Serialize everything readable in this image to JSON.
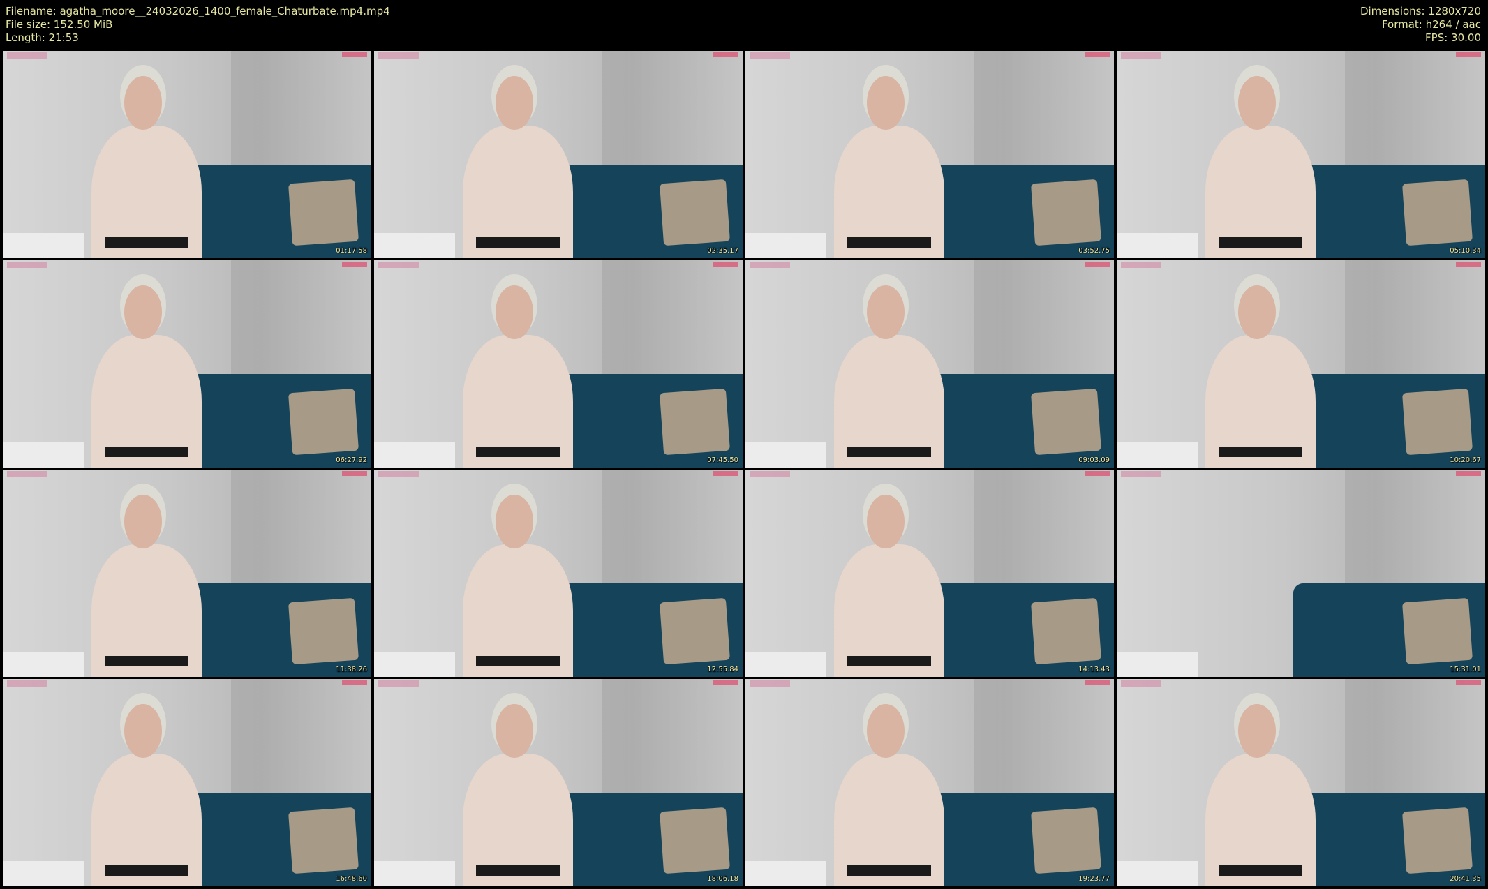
{
  "header": {
    "filename_line": "Filename: agatha_moore__24032026_1400_female_Chaturbate.mp4.mp4",
    "filesize_line": "File size: 152.50 MiB",
    "length_line": "Length: 21:53",
    "dimensions_line": "Dimensions: 1280x720",
    "format_line": "Format: h264 / aac",
    "fps_line": "FPS: 30.00"
  },
  "thumbnails": [
    {
      "timestamp": "01:17.58"
    },
    {
      "timestamp": "02:35.17"
    },
    {
      "timestamp": "03:52.75"
    },
    {
      "timestamp": "05:10.34"
    },
    {
      "timestamp": "06:27.92"
    },
    {
      "timestamp": "07:45.50"
    },
    {
      "timestamp": "09:03.09"
    },
    {
      "timestamp": "10:20.67"
    },
    {
      "timestamp": "11:38.26"
    },
    {
      "timestamp": "12:55.84"
    },
    {
      "timestamp": "14:13.43"
    },
    {
      "timestamp": "15:31.01"
    },
    {
      "timestamp": "16:48.60"
    },
    {
      "timestamp": "18:06.18"
    },
    {
      "timestamp": "19:23.77"
    },
    {
      "timestamp": "20:41.35"
    }
  ],
  "colors": {
    "background": "#000000",
    "header_text": "#e6e6a0",
    "timestamp_text": "#f0e6a0",
    "sofa": "#15445a"
  }
}
